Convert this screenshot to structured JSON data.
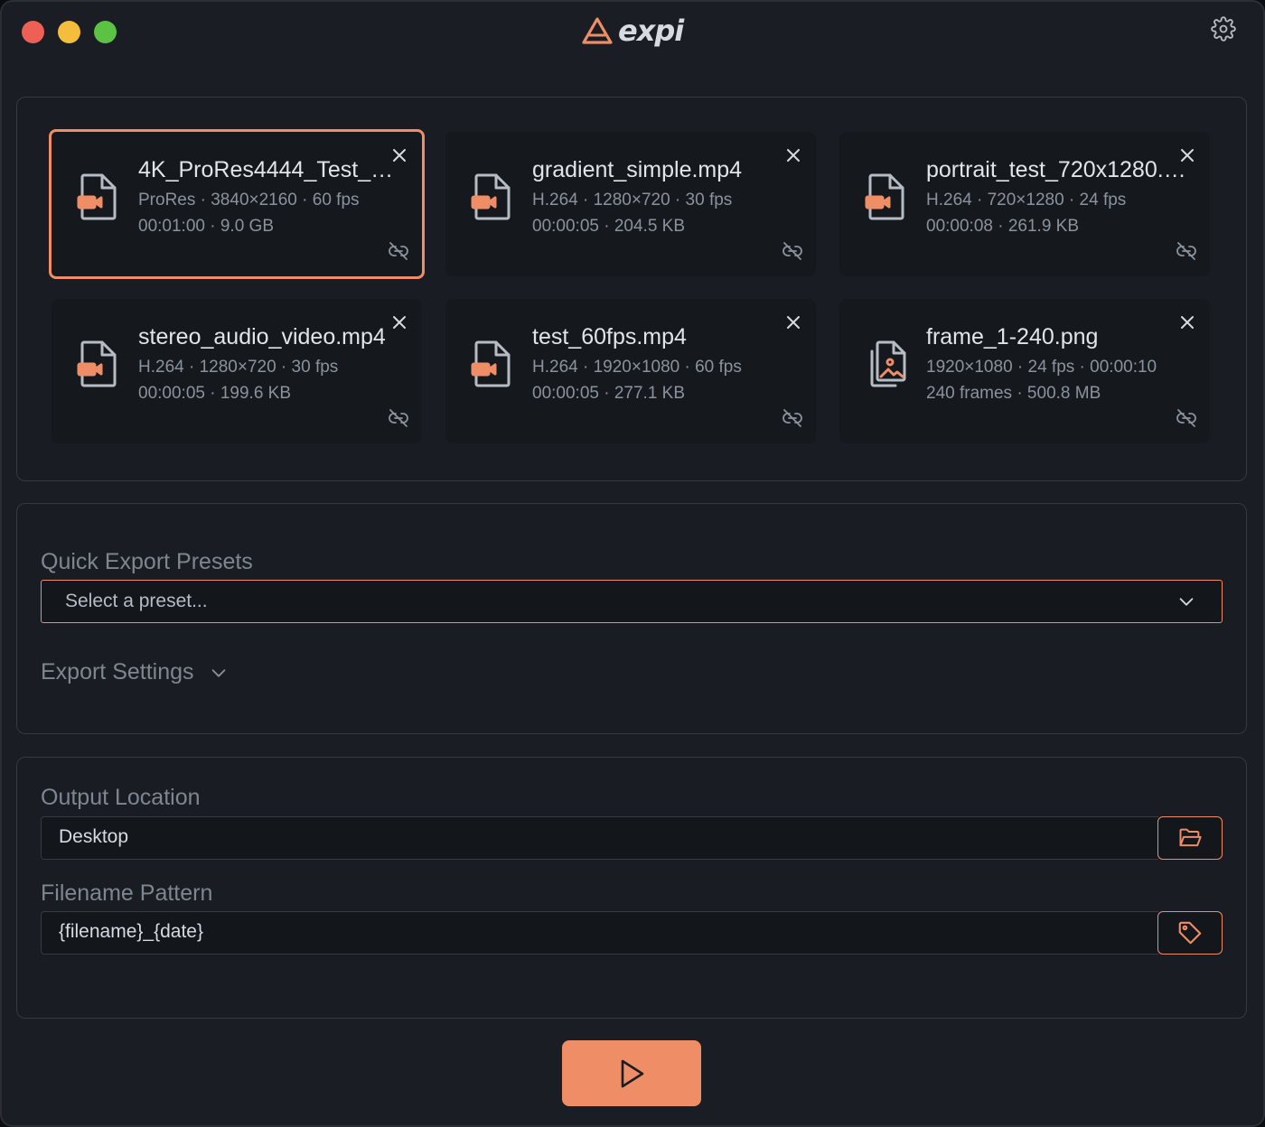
{
  "app": {
    "logo_text": "expi",
    "brand_color": "#ee8d66"
  },
  "files": [
    {
      "name": "4K_ProRes4444_Test_6…",
      "meta1": "ProRes · 3840×2160 · 60 fps",
      "meta2": "00:01:00 · 9.0 GB",
      "icon": "video-file-icon",
      "selected": true
    },
    {
      "name": "gradient_simple.mp4",
      "meta1": "H.264 · 1280×720 · 30 fps",
      "meta2": "00:00:05 · 204.5 KB",
      "icon": "video-file-icon",
      "selected": false
    },
    {
      "name": "portrait_test_720x1280.…",
      "meta1": "H.264 · 720×1280 · 24 fps",
      "meta2": "00:00:08 · 261.9 KB",
      "icon": "video-file-icon",
      "selected": false
    },
    {
      "name": "stereo_audio_video.mp4",
      "meta1": "H.264 · 1280×720 · 30 fps",
      "meta2": "00:00:05 · 199.6 KB",
      "icon": "video-file-icon",
      "selected": false
    },
    {
      "name": "test_60fps.mp4",
      "meta1": "H.264 · 1920×1080 · 60 fps",
      "meta2": "00:00:05 · 277.1 KB",
      "icon": "video-file-icon",
      "selected": false
    },
    {
      "name": "frame_1-240.png",
      "meta1": "1920×1080 · 24 fps · 00:00:10",
      "meta2": "240 frames · 500.8 MB",
      "icon": "image-sequence-icon",
      "selected": false
    }
  ],
  "presets": {
    "label": "Quick Export Presets",
    "select_placeholder": "Select a preset...",
    "export_settings_label": "Export Settings"
  },
  "output": {
    "location_label": "Output Location",
    "location_value": "Desktop",
    "pattern_label": "Filename Pattern",
    "pattern_value": "{filename}_{date}"
  }
}
